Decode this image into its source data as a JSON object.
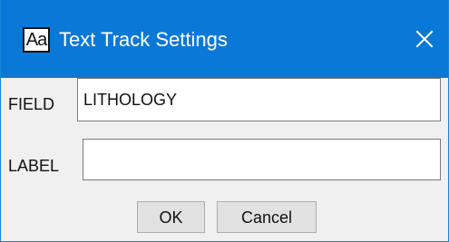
{
  "window": {
    "title": "Text Track Settings",
    "icon_text": "Aa",
    "close_icon": "close-icon",
    "titlebar_color": "#0a78d7",
    "icon": "text-font-icon"
  },
  "form": {
    "field_label": "FIELD",
    "field_value": "LITHOLOGY",
    "label_label": "LABEL",
    "label_value": ""
  },
  "buttons": {
    "ok_label": "OK",
    "cancel_label": "Cancel"
  }
}
